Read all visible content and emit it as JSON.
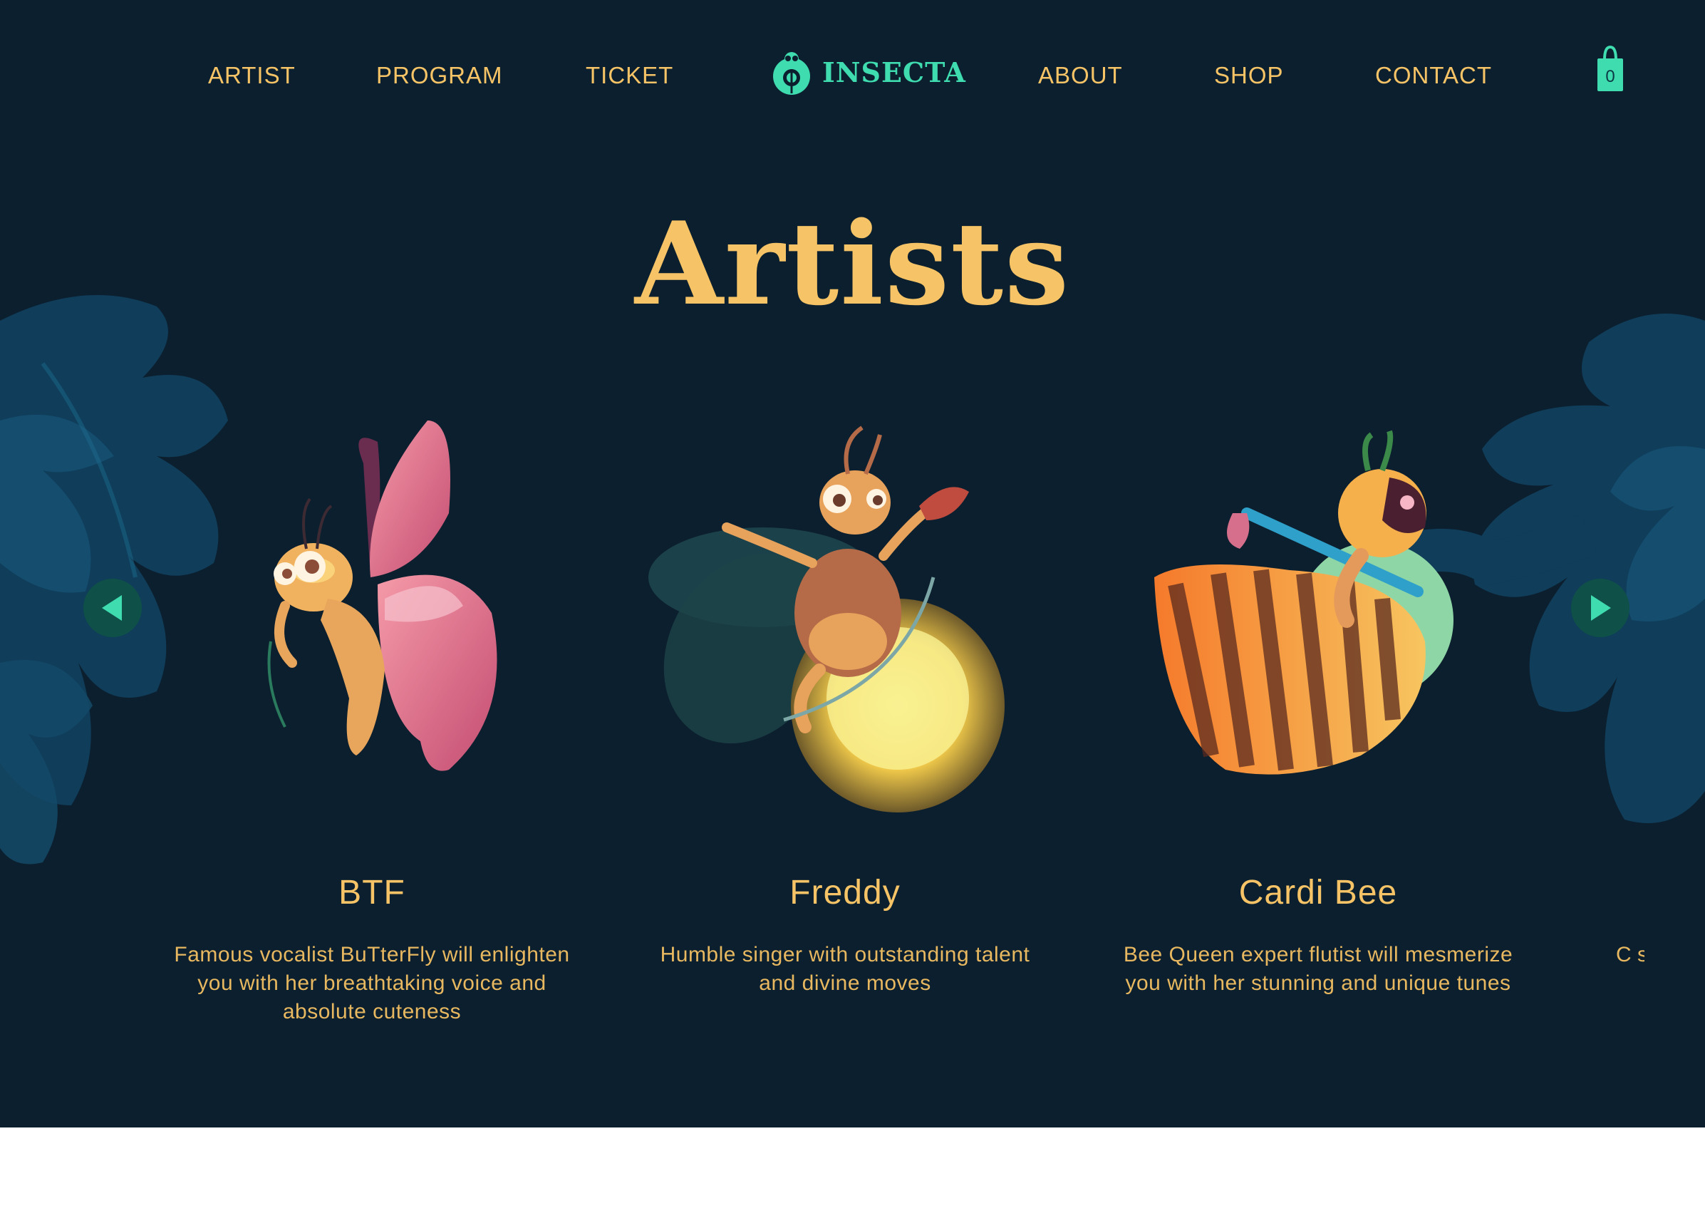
{
  "nav": {
    "left_links": [
      "ARTIST",
      "PROGRAM",
      "TICKET"
    ],
    "right_links": [
      "ABOUT",
      "SHOP",
      "CONTACT"
    ],
    "logo_text": "INSECTA",
    "cart_count": "0"
  },
  "section_title": "Artists",
  "artists": [
    {
      "name": "BTF",
      "description": "Famous vocalist BuTterFly will enlighten you with her breathtaking voice and absolute cuteness"
    },
    {
      "name": "Freddy",
      "description": "Humble singer with outstanding talent and divine moves"
    },
    {
      "name": "Cardi Bee",
      "description": "Bee Queen expert flutist will mesmerize you with her stunning and unique tunes"
    }
  ],
  "peek_description": "C sl",
  "icons": {
    "logo": "insect-logo-icon",
    "cart": "shopping-bag-icon",
    "prev": "arrow-left-icon",
    "next": "arrow-right-icon"
  },
  "colors": {
    "background": "#0c1f2e",
    "accent_gold": "#f6c466",
    "accent_teal": "#3fdcb0",
    "leaf": "#0f3d5a"
  }
}
